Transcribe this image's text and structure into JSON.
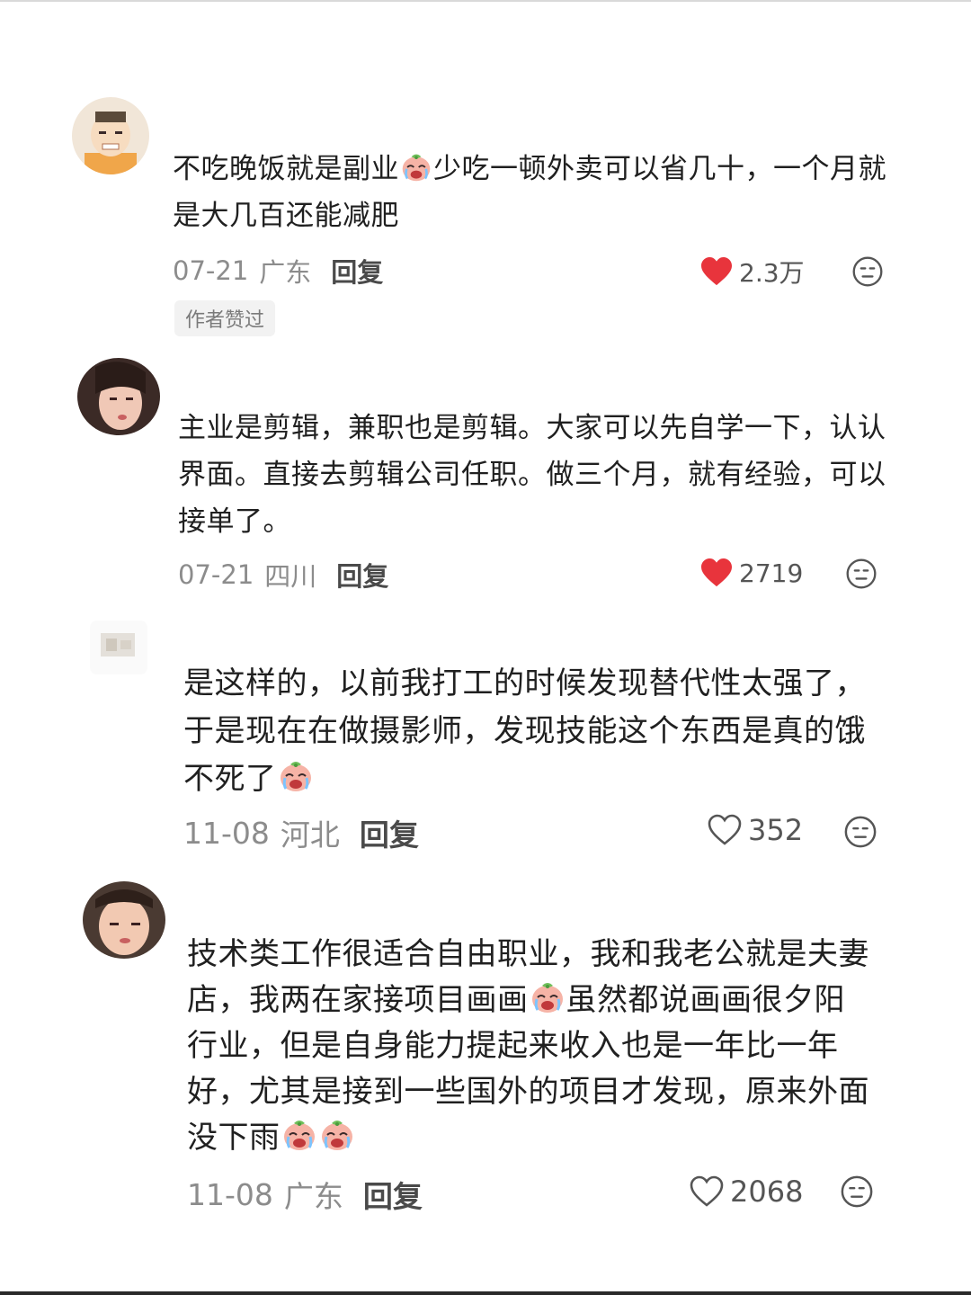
{
  "comments": [
    {
      "text_before": "不吃晚饭就是副业",
      "text_after": "少吃一顿外卖可以省几十，一个月就是大几百还能减肥",
      "date": "07-21",
      "location": "广东",
      "reply_label": "回复",
      "likes": "2.3万",
      "liked": true,
      "author_tag": "作者赞过"
    },
    {
      "text": "主业是剪辑，兼职也是剪辑。大家可以先自学一下，认认界面。直接去剪辑公司任职。做三个月，就有经验，可以接单了。",
      "date": "07-21",
      "location": "四川",
      "reply_label": "回复",
      "likes": "2719",
      "liked": true
    },
    {
      "text": "是这样的，以前我打工的时候发现替代性太强了，于是现在在做摄影师，发现技能这个东西是真的饿不死了",
      "date": "11-08",
      "location": "河北",
      "reply_label": "回复",
      "likes": "352",
      "liked": false
    },
    {
      "text_before": "技术类工作很适合自由职业，我和我老公就是夫妻店，我两在家接项目画画",
      "text_after": "虽然都说画画很夕阳行业，但是自身能力提起来收入也是一年比一年好，尤其是接到一些国外的项目才发现，原来外面没下雨",
      "date": "11-08",
      "location": "广东",
      "reply_label": "回复",
      "likes": "2068",
      "liked": false
    }
  ],
  "colors": {
    "heart_filled": "#e8343c",
    "meta_text": "#8c8c8c",
    "body_text": "#202020"
  },
  "icons": {
    "like_filled": "heart-filled-icon",
    "like_outline": "heart-outline-icon",
    "dislike": "dislike-face-icon",
    "emoji": "crying-face-emoji"
  }
}
